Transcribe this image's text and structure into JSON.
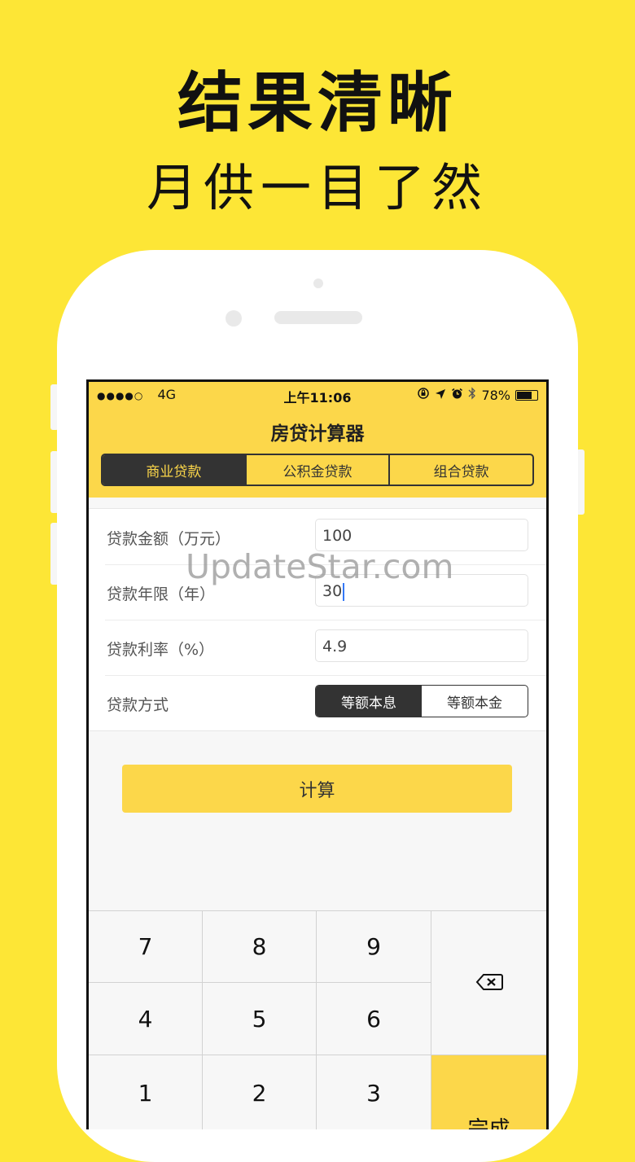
{
  "promo": {
    "headline": "结果清晰",
    "subline": "月供一目了然"
  },
  "status_bar": {
    "signal": "●●●●○",
    "network": "4G",
    "time": "上午11:06",
    "battery": "78%",
    "battery_level": 0.78
  },
  "app": {
    "title": "房贷计算器",
    "tabs": [
      {
        "label": "商业贷款",
        "active": true
      },
      {
        "label": "公积金贷款",
        "active": false
      },
      {
        "label": "组合贷款",
        "active": false
      }
    ]
  },
  "form": {
    "amount": {
      "label": "贷款金额（万元）",
      "value": "100"
    },
    "years": {
      "label": "贷款年限（年）",
      "value": "30"
    },
    "rate": {
      "label": "贷款利率（%）",
      "value": "4.9"
    },
    "method": {
      "label": "贷款方式",
      "options": [
        "等额本息",
        "等额本金"
      ],
      "selected": "等额本息"
    }
  },
  "calculate_label": "计算",
  "watermark": "UpdateStar.com",
  "keypad": {
    "keys": [
      "7",
      "8",
      "9",
      "4",
      "5",
      "6",
      "1",
      "2",
      "3"
    ],
    "done_label": "完成"
  },
  "colors": {
    "background": "#fde636",
    "accent": "#fcd74a",
    "dark": "#333333"
  }
}
